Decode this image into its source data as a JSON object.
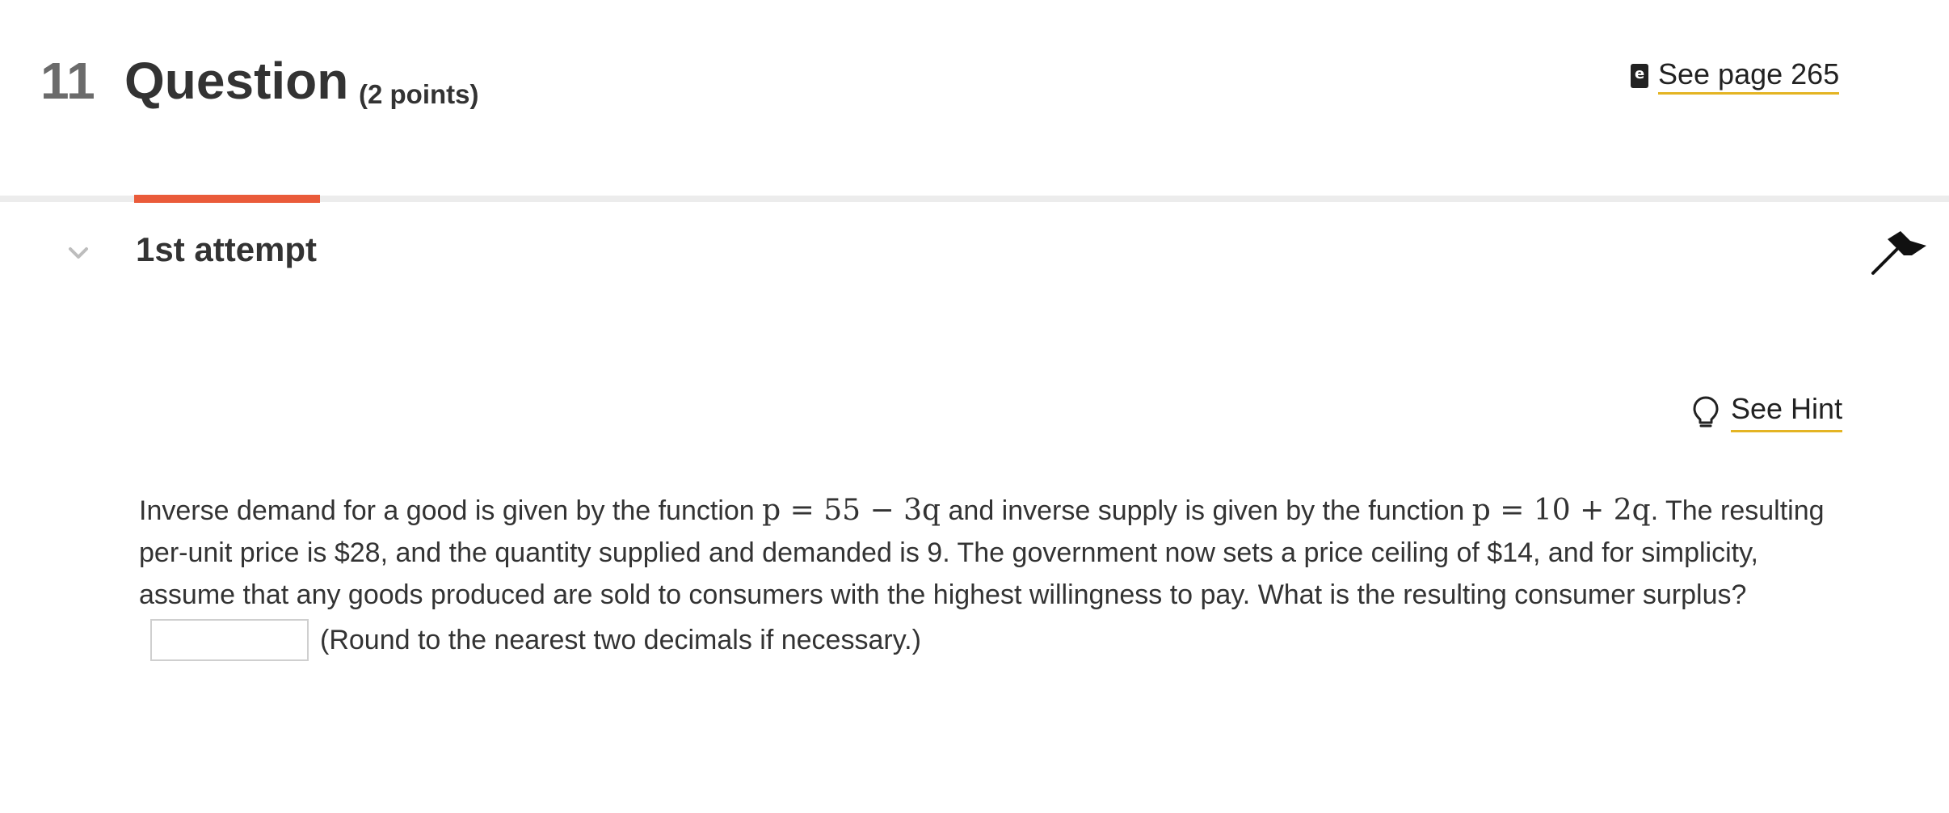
{
  "header": {
    "number": "11",
    "title": "Question",
    "points": "(2 points)",
    "see_page_label": "See page 265"
  },
  "attempt": {
    "label": "1st attempt"
  },
  "hint": {
    "label": "See Hint"
  },
  "question": {
    "part1": "Inverse demand for a good is given by the function ",
    "demand_eq": "p = 55 − 3q",
    "part2": " and inverse supply is given by the function ",
    "supply_eq": "p = 10 + 2q",
    "part3": ". The resulting per-unit price is $28, and the quantity supplied and demanded is 9. The government now sets a price ceiling of $14, and for simplicity, assume that any goods produced are sold to consumers with the highest willingness to pay. What is the resulting consumer surplus?"
  },
  "answer": {
    "value": "",
    "note": "(Round to the nearest two decimals if necessary.)"
  },
  "colors": {
    "accent_underline": "#e4b423",
    "active_tab": "#ea5b3a",
    "divider": "#ececec"
  },
  "icons": {
    "book": "ebook-icon",
    "chevron": "chevron-down-icon",
    "flag": "flag-icon",
    "bulb": "lightbulb-icon"
  }
}
